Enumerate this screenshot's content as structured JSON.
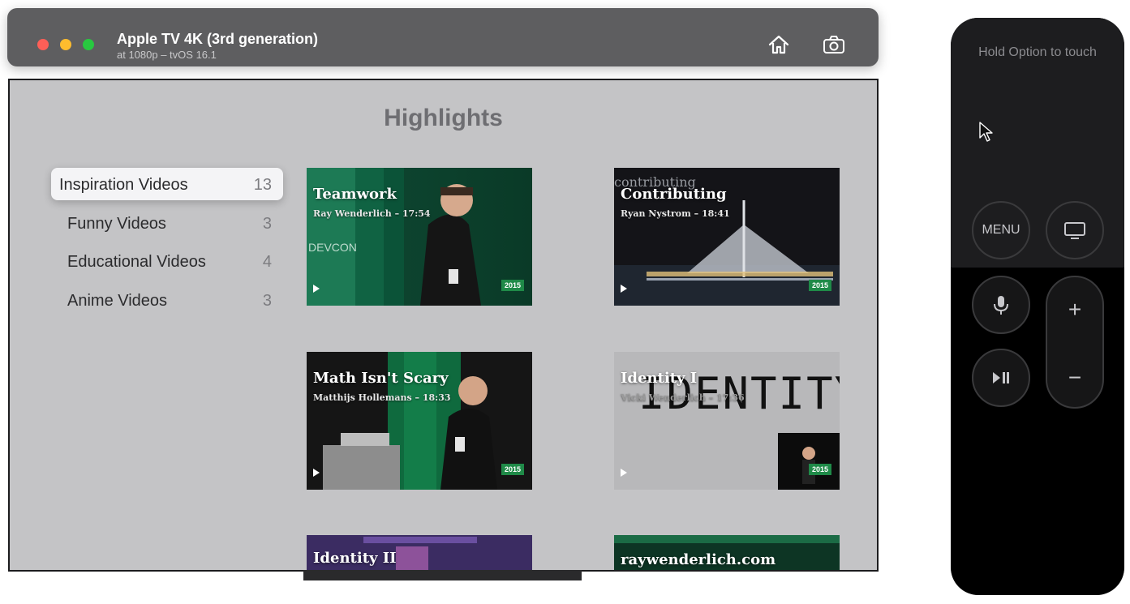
{
  "window": {
    "title": "Apple TV 4K (3rd generation)",
    "subtitle": "at 1080p – tvOS 16.1",
    "icons": [
      "home-icon",
      "screenshot-icon"
    ]
  },
  "page": {
    "title": "Highlights"
  },
  "categories": [
    {
      "label": "Inspiration Videos",
      "count": "13",
      "selected": true
    },
    {
      "label": "Funny Videos",
      "count": "3",
      "selected": false
    },
    {
      "label": "Educational Videos",
      "count": "4",
      "selected": false
    },
    {
      "label": "Anime Videos",
      "count": "3",
      "selected": false
    }
  ],
  "videos": [
    {
      "title": "Teamwork",
      "subtitle": "Ray Wenderlich  –  17:54",
      "year": "2015"
    },
    {
      "title": "Contributing",
      "subtitle": "Ryan Nystrom  –  18:41",
      "year": "2015"
    },
    {
      "title": "Math Isn't Scary",
      "subtitle": "Matthijs Hollemans  –  18:33",
      "year": "2015"
    },
    {
      "title": "Identity I",
      "subtitle": "Vicki Wenderlich  –  17:36",
      "year": "2015"
    },
    {
      "title": "Identity II"
    },
    {
      "title": "raywenderlich.com"
    }
  ],
  "tile_art": {
    "teamwork_banner": "DEVCON",
    "contributing_bg": "contributing",
    "identity_bg": "IDENTITY"
  },
  "remote": {
    "hint": "Hold Option to touch",
    "menu_label": "MENU",
    "vol_plus": "+",
    "vol_minus": "−"
  },
  "colors": {
    "accent_green": "#1f8a48",
    "screen_bg": "#c4c4c6",
    "titlebar": "#5e5e60"
  }
}
